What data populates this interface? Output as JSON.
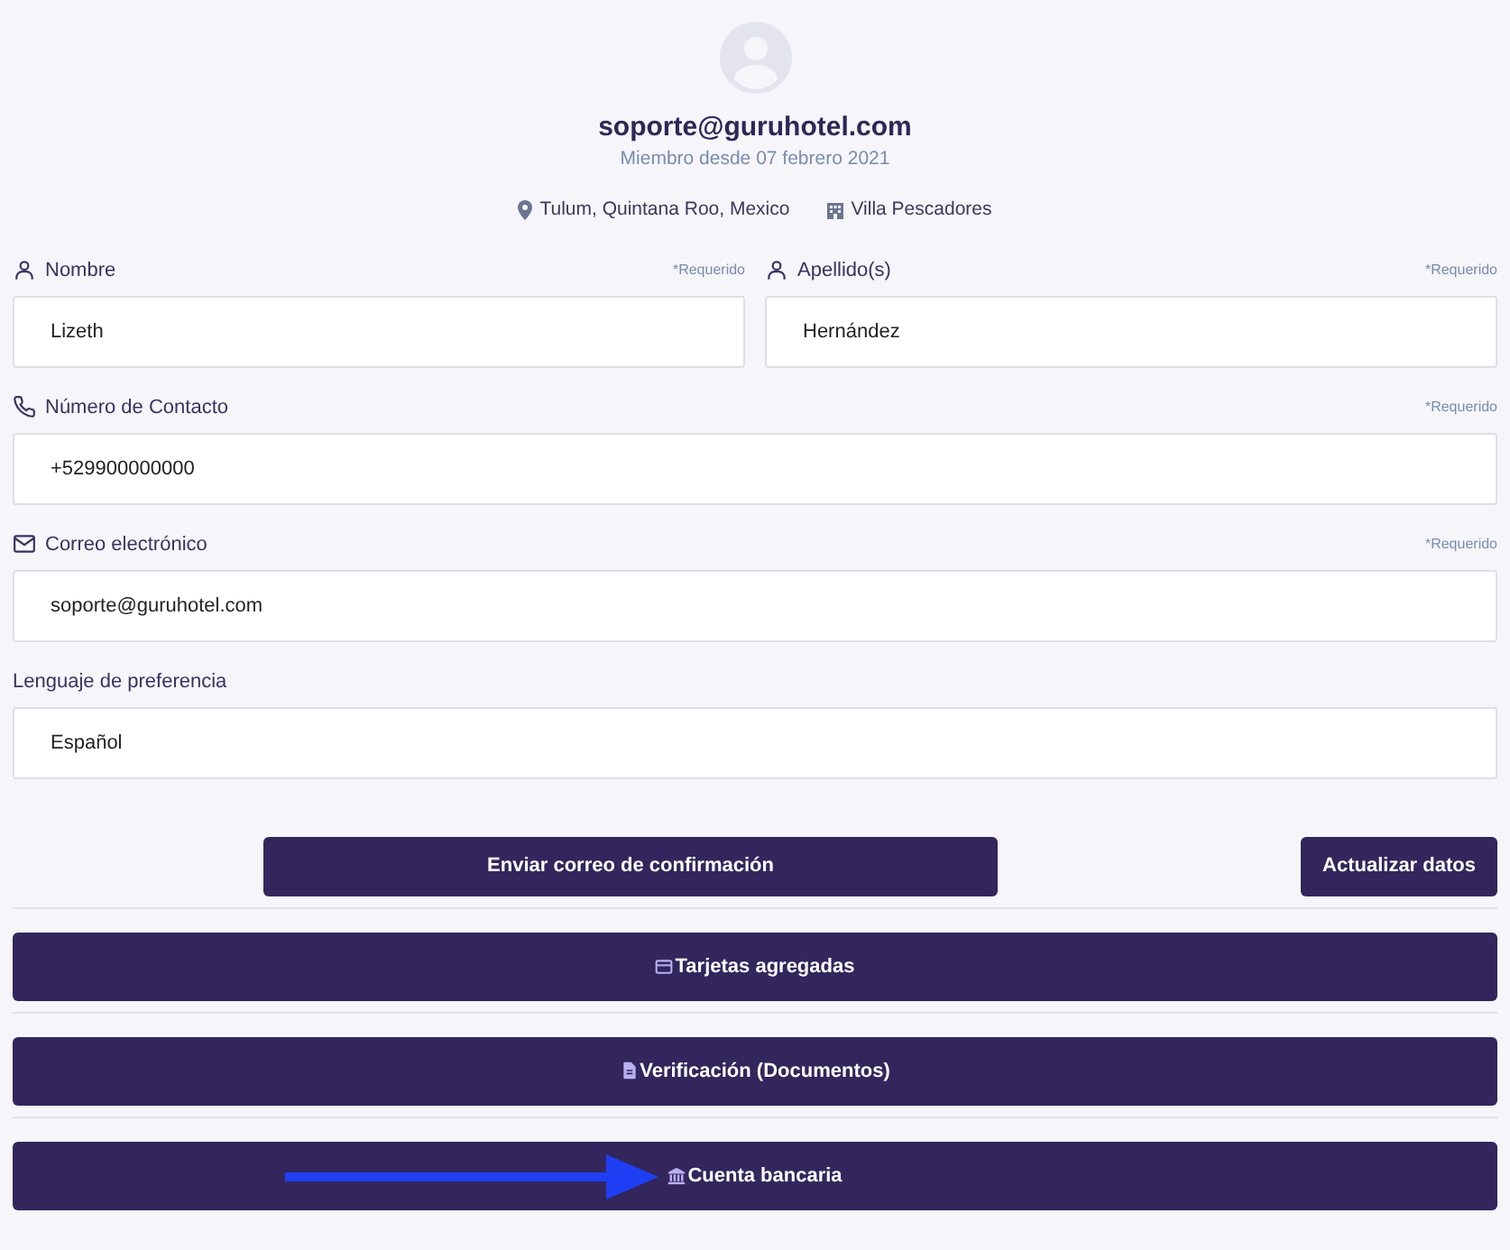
{
  "profile": {
    "email": "soporte@guruhotel.com",
    "member_since": "Miembro desde 07 febrero 2021",
    "location": "Tulum, Quintana Roo, Mexico",
    "property": "Villa Pescadores"
  },
  "form_rows": [
    [
      {
        "kind": "person",
        "label": "Nombre",
        "required": "*Requerido",
        "value": "Lizeth"
      },
      {
        "kind": "person",
        "label": "Apellido(s)",
        "required": "*Requerido",
        "value": "Hernández"
      }
    ],
    [
      {
        "kind": "phone",
        "label": "Número de Contacto",
        "required": "*Requerido",
        "value": "+529900000000"
      }
    ],
    [
      {
        "kind": "mail",
        "label": "Correo electrónico",
        "required": "*Requerido",
        "value": "soporte@guruhotel.com"
      }
    ],
    [
      {
        "kind": "none",
        "label": "Lenguaje de preferencia",
        "value": "Español"
      }
    ]
  ],
  "actions": {
    "send": "Enviar correo de confirmación",
    "update": "Actualizar datos"
  },
  "sections": [
    {
      "kind": "card",
      "label": "Tarjetas agregadas",
      "arrow": false
    },
    {
      "kind": "document",
      "label": "Verificación (Documentos)",
      "arrow": false
    },
    {
      "kind": "bank",
      "label": "Cuenta bancaria",
      "arrow": true
    }
  ]
}
